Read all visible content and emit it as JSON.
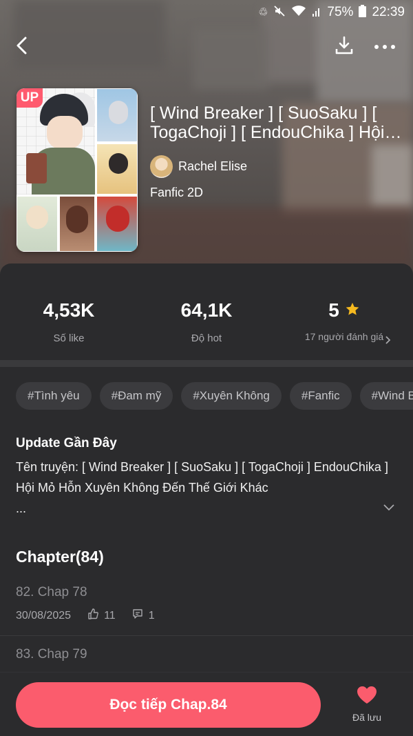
{
  "status_bar": {
    "battery": "75%",
    "time": "22:39"
  },
  "story": {
    "cover_badge": "UP",
    "title": "[ Wind Breaker ] [ SuoSaku ] [ TogaChoji ] [ EndouChika ] Hội Mỏ Hỗn Xuyên Không Đến Thế Giới Khác",
    "author": "Rachel Elise",
    "category": "Fanfic 2D"
  },
  "stats": {
    "likes": {
      "value": "4,53K",
      "label": "Số like"
    },
    "hot": {
      "value": "64,1K",
      "label": "Độ hot"
    },
    "rating": {
      "value": "5",
      "label": "17 người đánh giá"
    }
  },
  "tags": [
    "#Tình yêu",
    "#Đam mỹ",
    "#Xuyên Không",
    "#Fanfic",
    "#Wind Breaker"
  ],
  "description": {
    "title": "Update Gần Đây",
    "text": "Tên truyện: [ Wind Breaker ] [ SuoSaku ] [ TogaChoji ] EndouChika ] Hội Mỏ Hỗn Xuyên Không Đến Thế Giới Khác",
    "ellipsis": "..."
  },
  "chapters": {
    "heading": "Chapter(84)",
    "items": [
      {
        "title": "82. Chap 78",
        "date": "30/08/2025",
        "likes": "11",
        "comments": "1"
      },
      {
        "title": "83. Chap 79"
      }
    ]
  },
  "actions": {
    "read_label": "Đọc tiếp Chap.84",
    "saved_label": "Đã lưu"
  },
  "colors": {
    "accent": "#fb5c6d",
    "star": "#f5b91f",
    "background": "#2b2b2d"
  },
  "icons": [
    "back-icon",
    "download-icon",
    "more-icon",
    "star-icon",
    "chevron-right-icon",
    "chevron-down-icon",
    "thumb-up-icon",
    "comment-icon",
    "heart-icon"
  ]
}
